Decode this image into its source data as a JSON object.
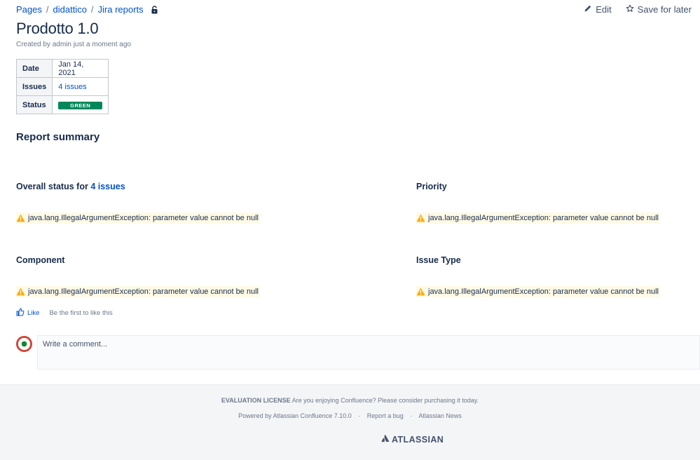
{
  "breadcrumb": {
    "items": [
      "Pages",
      "didattico",
      "Jira reports"
    ]
  },
  "actions": {
    "edit": "Edit",
    "save_for_later": "Save for later"
  },
  "page": {
    "title": "Prodotto 1.0",
    "byline": "Created by admin just a moment ago"
  },
  "properties": {
    "date_label": "Date",
    "date_value": "Jan 14, 2021",
    "issues_label": "Issues",
    "issues_value": "4 issues",
    "status_label": "Status",
    "status_value": "GREEN"
  },
  "report": {
    "heading": "Report summary",
    "overall": {
      "prefix": "Overall status for",
      "link": "4 issues",
      "error": "java.lang.IllegalArgumentException: parameter value cannot be null"
    },
    "priority": {
      "title": "Priority",
      "error": "java.lang.IllegalArgumentException: parameter value cannot be null"
    },
    "component": {
      "title": "Component",
      "error": "java.lang.IllegalArgumentException: parameter value cannot be null"
    },
    "issue_type": {
      "title": "Issue Type",
      "error": "java.lang.IllegalArgumentException: parameter value cannot be null"
    }
  },
  "like": {
    "label": "Like",
    "text": "Be the first to like this"
  },
  "comment": {
    "placeholder": "Write a comment..."
  },
  "footer": {
    "eval_label": "EVALUATION LICENSE",
    "eval_text": "Are you enjoying Confluence? Please consider purchasing it today.",
    "powered": "Powered by Atlassian Confluence 7.10.0",
    "report_bug": "Report a bug",
    "news": "Atlassian News",
    "logo": "ATLASSIAN"
  },
  "colors": {
    "link": "#0052cc",
    "status_green": "#00875a",
    "warning": "#ffab00",
    "footer_bg": "#f4f5f7"
  },
  "icons": [
    "lock-icon",
    "pencil-icon",
    "star-icon",
    "warning-icon",
    "thumbs-up-icon",
    "atlassian-logo-icon"
  ]
}
